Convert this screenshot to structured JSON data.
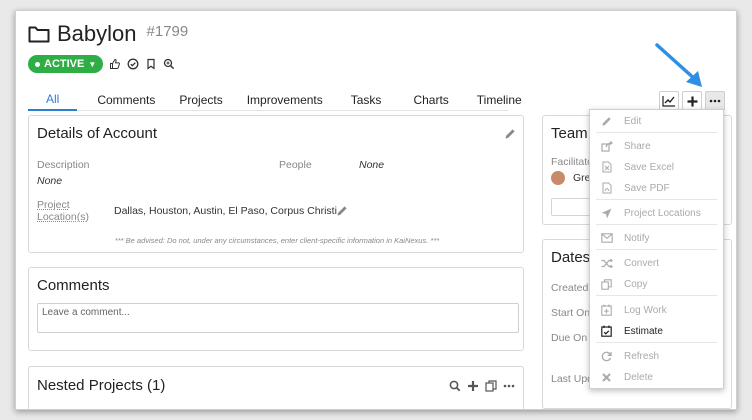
{
  "header": {
    "title": "Babylon",
    "number": "#1799",
    "status": "ACTIVE"
  },
  "tabs": [
    "All",
    "Comments",
    "Projects",
    "Improvements",
    "Tasks",
    "Charts",
    "Timeline"
  ],
  "details": {
    "title": "Details of Account",
    "description_label": "Description",
    "description_value": "None",
    "people_label": "People",
    "people_value": "None",
    "location_label_1": "Project",
    "location_label_2": "Location(s)",
    "location_value": "Dallas, Houston, Austin, El Paso, Corpus Christi",
    "advisory": "*** Be advised: Do not, under any circumstances, enter client-specific information in KaiNexus. ***"
  },
  "comments": {
    "title": "Comments",
    "placeholder": "Leave a comment..."
  },
  "nested": {
    "title": "Nested Projects (1)"
  },
  "team": {
    "title": "Team",
    "facilitator_label": "Facilitato",
    "member": "Gre"
  },
  "dates": {
    "title": "Dates",
    "rows": [
      "Created",
      "Start On",
      "Due On",
      "Last Upd"
    ]
  },
  "menu": {
    "items": [
      {
        "label": "Edit",
        "icon": "pencil-icon",
        "enabled": false
      },
      {
        "label": "Share",
        "icon": "share-icon",
        "enabled": false
      },
      {
        "label": "Save Excel",
        "icon": "excel-file-icon",
        "enabled": false
      },
      {
        "label": "Save PDF",
        "icon": "pdf-file-icon",
        "enabled": false
      },
      {
        "label": "Project Locations",
        "icon": "location-arrow-icon",
        "enabled": false
      },
      {
        "label": "Notify",
        "icon": "envelope-icon",
        "enabled": false
      },
      {
        "label": "Convert",
        "icon": "shuffle-icon",
        "enabled": false
      },
      {
        "label": "Copy",
        "icon": "copy-icon",
        "enabled": false
      },
      {
        "label": "Log Work",
        "icon": "calendar-plus-icon",
        "enabled": false
      },
      {
        "label": "Estimate",
        "icon": "calendar-check-icon",
        "enabled": true
      },
      {
        "label": "Refresh",
        "icon": "refresh-icon",
        "enabled": false
      },
      {
        "label": "Delete",
        "icon": "x-icon",
        "enabled": false
      }
    ]
  },
  "colors": {
    "accent": "#2d7fd1",
    "active_badge": "#2eae44",
    "arrow": "#2d8fe6"
  }
}
